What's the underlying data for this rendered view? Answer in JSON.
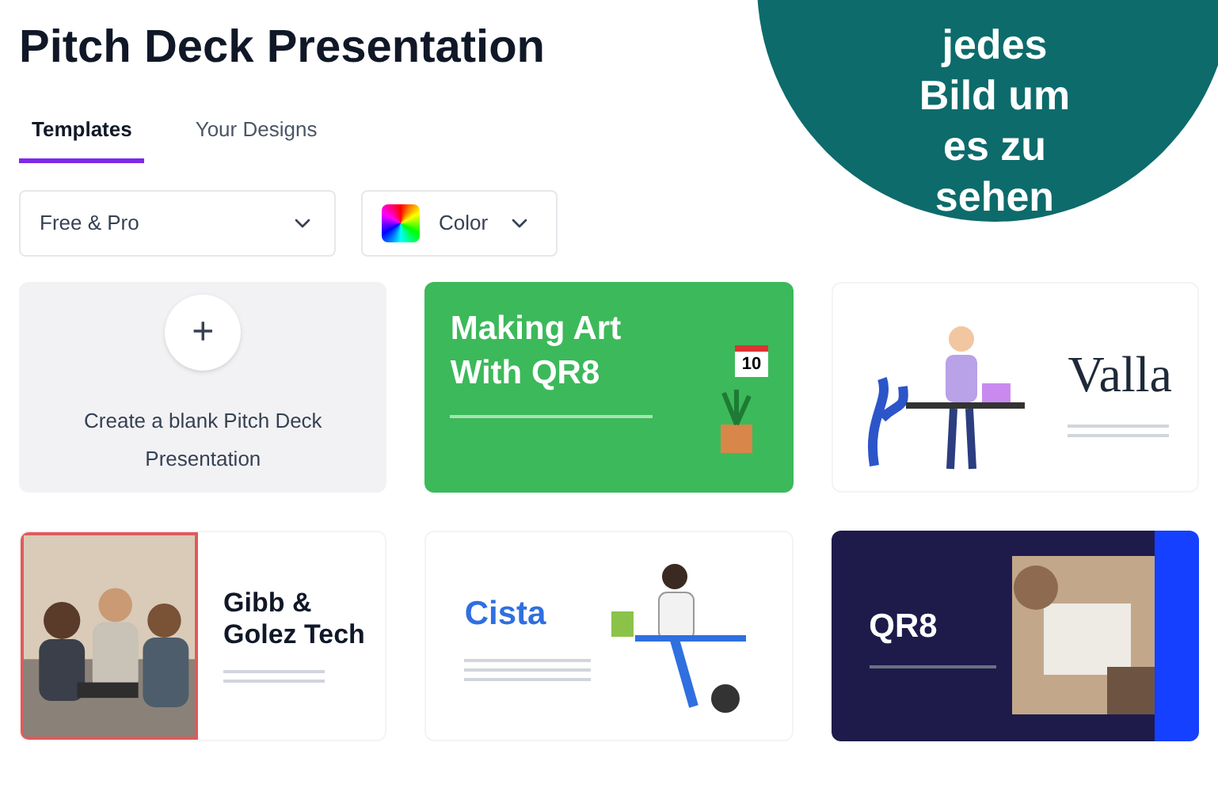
{
  "title": "Pitch Deck Presentation",
  "tabs": [
    {
      "label": "Templates",
      "selected": true
    },
    {
      "label": "Your Designs",
      "selected": false
    }
  ],
  "filters": [
    {
      "kind": "plain",
      "label": "Free & Pro"
    },
    {
      "kind": "color",
      "label": "Color"
    }
  ],
  "templates": [
    {
      "kind": "blank",
      "label": "Create a blank Pitch Deck Presentation",
      "button": "+"
    },
    {
      "kind": "art",
      "heading": "Making Art With QR8",
      "badge": "10"
    },
    {
      "kind": "valla",
      "heading": "Valla"
    },
    {
      "kind": "gibb",
      "heading": "Gibb & Golez Tech"
    },
    {
      "kind": "cista",
      "heading": "Cista"
    },
    {
      "kind": "qr8",
      "heading": "QR8"
    }
  ],
  "overlay": {
    "lines": [
      "jedes",
      "Bild um",
      "es zu",
      "sehen"
    ]
  }
}
